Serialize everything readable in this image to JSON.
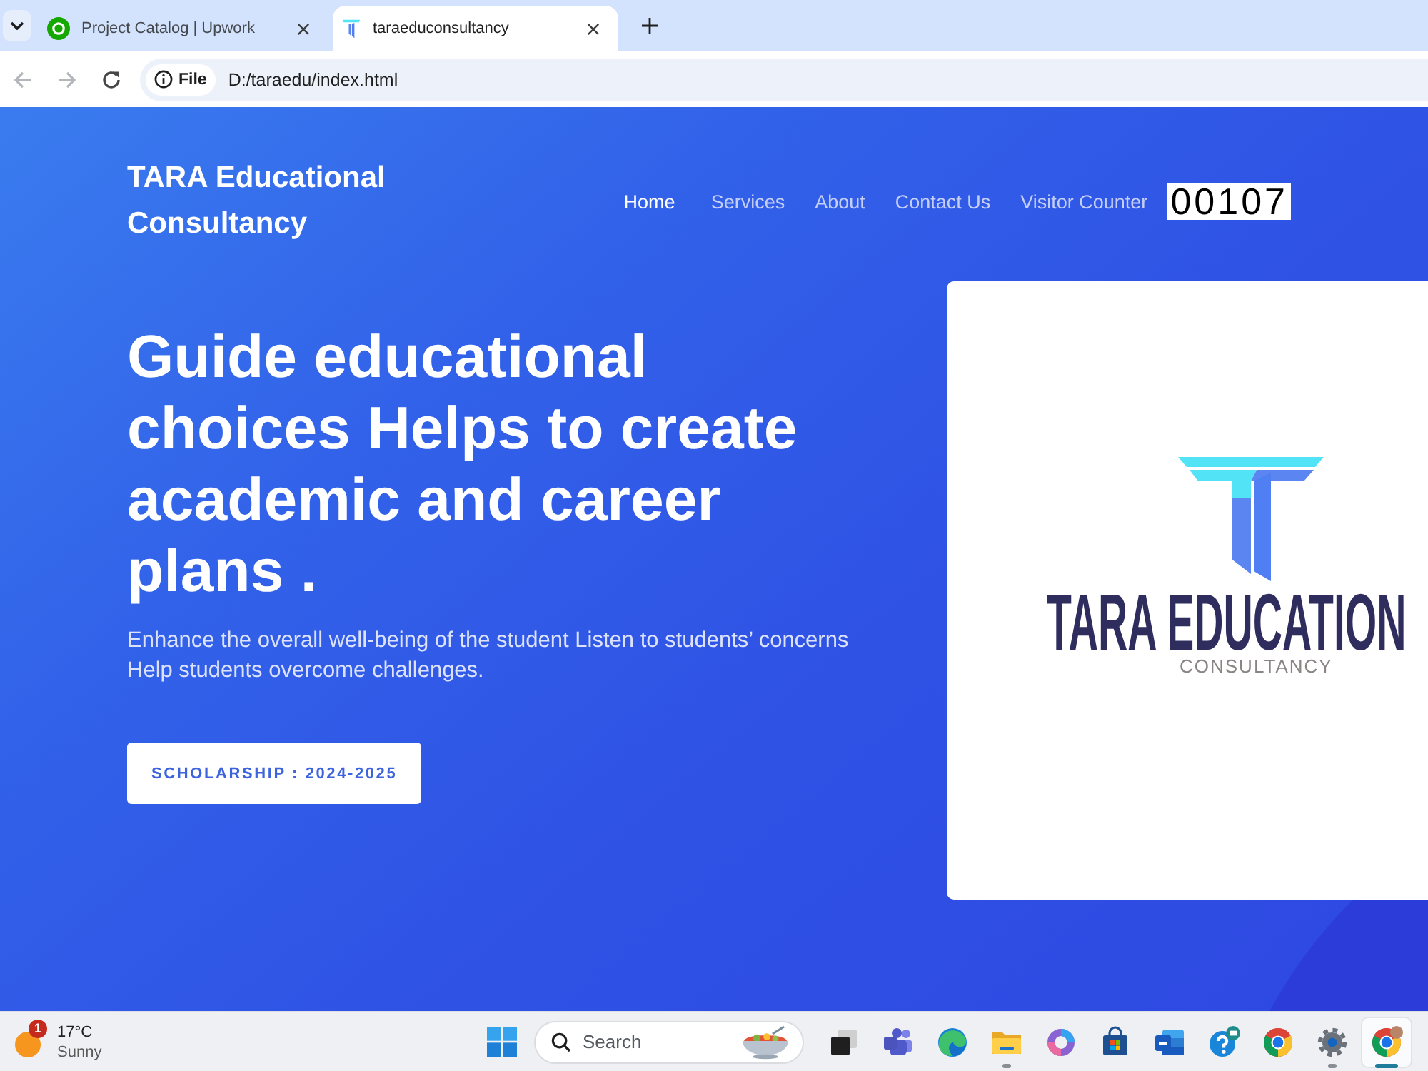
{
  "browser": {
    "tabs": [
      {
        "title": "Project Catalog | Upwork",
        "selected": false
      },
      {
        "title": "taraeduconsultancy",
        "selected": true
      }
    ],
    "back": {
      "disabled": true
    },
    "forward": {
      "disabled": true
    },
    "address": {
      "chip": "File",
      "url": "D:/taraedu/index.html"
    }
  },
  "header": {
    "brand": "TARA Educational Consultancy",
    "nav": [
      {
        "label": "Home",
        "selected": true
      },
      {
        "label": "Services",
        "selected": false
      },
      {
        "label": "About",
        "selected": false
      },
      {
        "label": "Contact Us",
        "selected": false
      },
      {
        "label": "Visitor Counter",
        "selected": false
      }
    ],
    "visitor_count": "00107"
  },
  "hero": {
    "title": "Guide educational choices Helps to create academic and career plans .",
    "text": "Enhance the overall well-being of the student Listen to students’ concerns Help students overcome challenges.",
    "button": "SCHOLARSHIP : 2024-2025",
    "logo": {
      "wordmark": "TARA EDUCATION",
      "tagline": "CONSULTANCY"
    }
  },
  "taskbar": {
    "weather": {
      "badge": "1",
      "temperature": "17°C",
      "condition": "Sunny"
    },
    "search": {
      "placeholder": "Search"
    },
    "apps": [
      {
        "running": false,
        "selected": false
      },
      {
        "running": false,
        "selected": false
      },
      {
        "running": false,
        "selected": false
      },
      {
        "running": true,
        "selected": false
      },
      {
        "running": false,
        "selected": false
      },
      {
        "running": false,
        "selected": false
      },
      {
        "running": false,
        "selected": false
      },
      {
        "running": false,
        "selected": false
      },
      {
        "running": false,
        "selected": false
      },
      {
        "running": true,
        "selected": false
      },
      {
        "running": true,
        "selected": true
      }
    ]
  }
}
